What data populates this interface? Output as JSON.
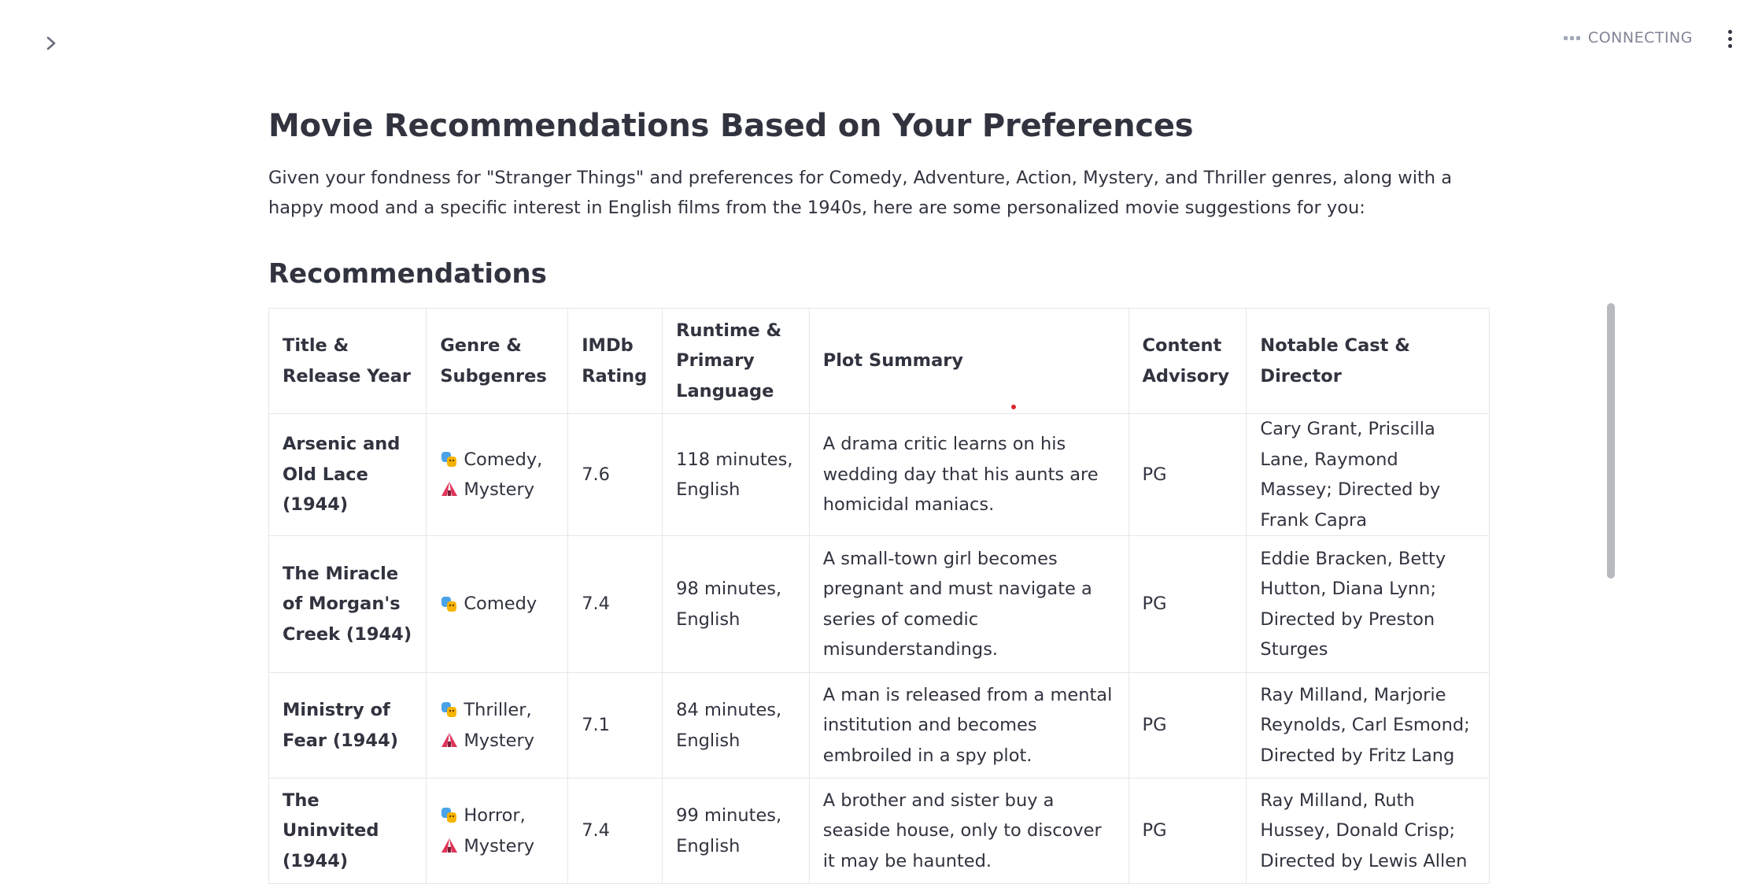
{
  "header": {
    "status_text": "CONNECTING"
  },
  "page": {
    "title": "Movie Recommendations Based on Your Preferences",
    "intro": "Given your fondness for \"Stranger Things\" and preferences for Comedy, Adventure, Action, Mystery, and Thriller genres, along with a happy mood and a specific interest in English films from the 1940s, here are some personalized movie suggestions for you:",
    "section_title": "Recommendations"
  },
  "table": {
    "headers": [
      "Title & Release Year",
      "Genre & Subgenres",
      "IMDb Rating",
      "Runtime & Primary Language",
      "Plot Summary",
      "Content Advisory",
      "Notable Cast & Director"
    ],
    "rows": [
      {
        "title": "Arsenic and Old Lace (1944)",
        "genres": [
          "Comedy,",
          "Mystery"
        ],
        "rating": "7.6",
        "runtime": "118 minutes, English",
        "plot": "A drama critic learns on his wedding day that his aunts are homicidal maniacs.",
        "advisory": "PG",
        "cast": "Cary Grant, Priscilla Lane, Raymond Massey; Directed by Frank Capra"
      },
      {
        "title": "The Miracle of Morgan's Creek (1944)",
        "genres": [
          "Comedy"
        ],
        "rating": "7.4",
        "runtime": "98 minutes, English",
        "plot": "A small-town girl becomes pregnant and must navigate a series of comedic misunderstandings.",
        "advisory": "PG",
        "cast": "Eddie Bracken, Betty Hutton, Diana Lynn; Directed by Preston Sturges"
      },
      {
        "title": "Ministry of Fear (1944)",
        "genres": [
          "Thriller,",
          "Mystery"
        ],
        "rating": "7.1",
        "runtime": "84 minutes, English",
        "plot": "A man is released from a mental institution and becomes embroiled in a spy plot.",
        "advisory": "PG",
        "cast": "Ray Milland, Marjorie Reynolds, Carl Esmond; Directed by Fritz Lang"
      },
      {
        "title": "The Uninvited (1944)",
        "genres": [
          "Horror,",
          "Mystery"
        ],
        "rating": "7.4",
        "runtime": "99 minutes, English",
        "plot": "A brother and sister buy a seaside house, only to discover it may be haunted.",
        "advisory": "PG",
        "cast": "Ray Milland, Ruth Hussey, Donald Crisp; Directed by Lewis Allen"
      }
    ]
  },
  "icons": {
    "sidebar_toggle": "chevron-right-icon",
    "status": "ellipsis-icon",
    "menu": "vertical-dots-icon",
    "genre_first": "performing-arts-masks-icon",
    "genre_second": "circus-tent-icon"
  },
  "colors": {
    "text": "#31333f",
    "muted": "#808495",
    "border": "#e6e6ea",
    "scrollbar": "#b9b9c0",
    "accent_red": "#e0262b"
  }
}
